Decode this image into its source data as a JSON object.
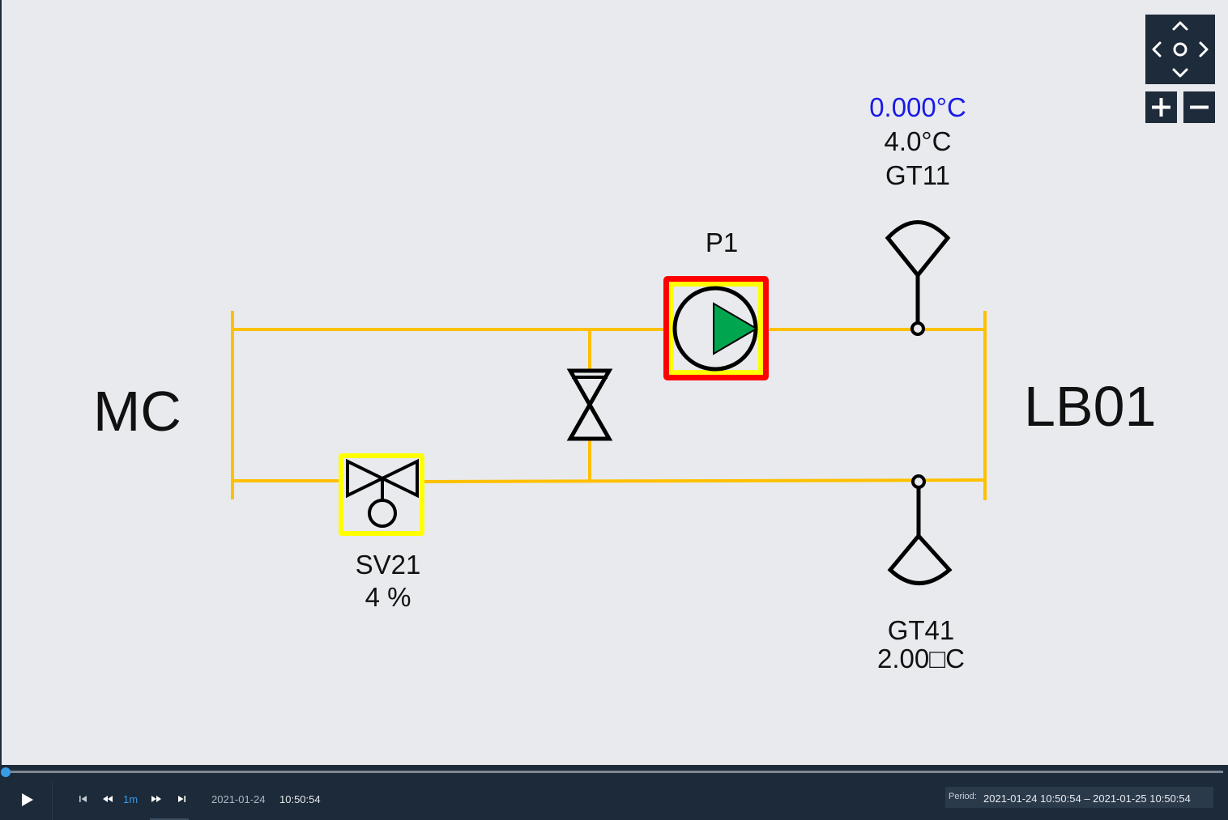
{
  "diagram": {
    "left_system": "MC",
    "right_system": "LB01",
    "pump": {
      "name": "P1",
      "state": "running"
    },
    "valve": {
      "name": "SV21",
      "value": "4 %"
    },
    "sensor_supply": {
      "setpoint": "0.000°C",
      "value": "4.0°C",
      "name": "GT11"
    },
    "sensor_return": {
      "name": "GT41",
      "value": "2.00□C"
    }
  },
  "colors": {
    "pipe": "#ffc000",
    "alarm": "#ff0000",
    "highlight": "#ffff00",
    "pump_running": "#00a550",
    "setpoint_text": "#1a1ae6"
  },
  "nav": {
    "pad_icon": "pan-arrows-icon",
    "zoom_in_icon": "plus-icon",
    "zoom_out_icon": "minus-icon"
  },
  "playback": {
    "step": "1m",
    "date": "2021-01-24",
    "time": "10:50:54",
    "period_label": "Period:",
    "period_range": "2021-01-24 10:50:54 – 2021-01-25 10:50:54",
    "progress": 0
  }
}
